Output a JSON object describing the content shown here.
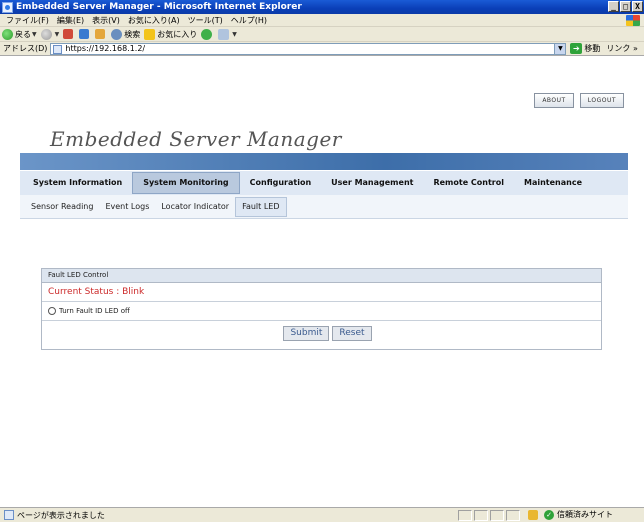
{
  "window": {
    "title": "Embedded Server Manager - Microsoft Internet Explorer",
    "controls": [
      "_",
      "□",
      "X"
    ]
  },
  "menubar": [
    "ファイル(F)",
    "編集(E)",
    "表示(V)",
    "お気に入り(A)",
    "ツール(T)",
    "ヘルプ(H)"
  ],
  "toolbar": {
    "back": "戻る",
    "search": "検索",
    "favorites": "お気に入り"
  },
  "address": {
    "label": "アドレス(D)",
    "url": "https://192.168.1.2/",
    "go": "移動",
    "links": "リンク »"
  },
  "header": {
    "about": "ABOUT",
    "logout": "LOGOUT",
    "brand": "Embedded Server Manager"
  },
  "nav": {
    "tabs": [
      "System Information",
      "System Monitoring",
      "Configuration",
      "User Management",
      "Remote Control",
      "Maintenance"
    ],
    "active": "System Monitoring"
  },
  "subnav": {
    "tabs": [
      "Sensor Reading",
      "Event Logs",
      "Locator Indicator",
      "Fault LED"
    ],
    "active": "Fault LED"
  },
  "panel": {
    "title": "Fault LED Control",
    "status": "Current Status : Blink",
    "option": "Turn Fault ID LED off",
    "submit": "Submit",
    "reset": "Reset"
  },
  "statusbar": {
    "message": "ページが表示されました",
    "zone": "信頼済みサイト"
  },
  "colors": {
    "title_bar": "#0a3fb8",
    "status_text": "#cc2a2a",
    "nav_bg": "#dfe8f4",
    "band": "#3d6ea9"
  }
}
